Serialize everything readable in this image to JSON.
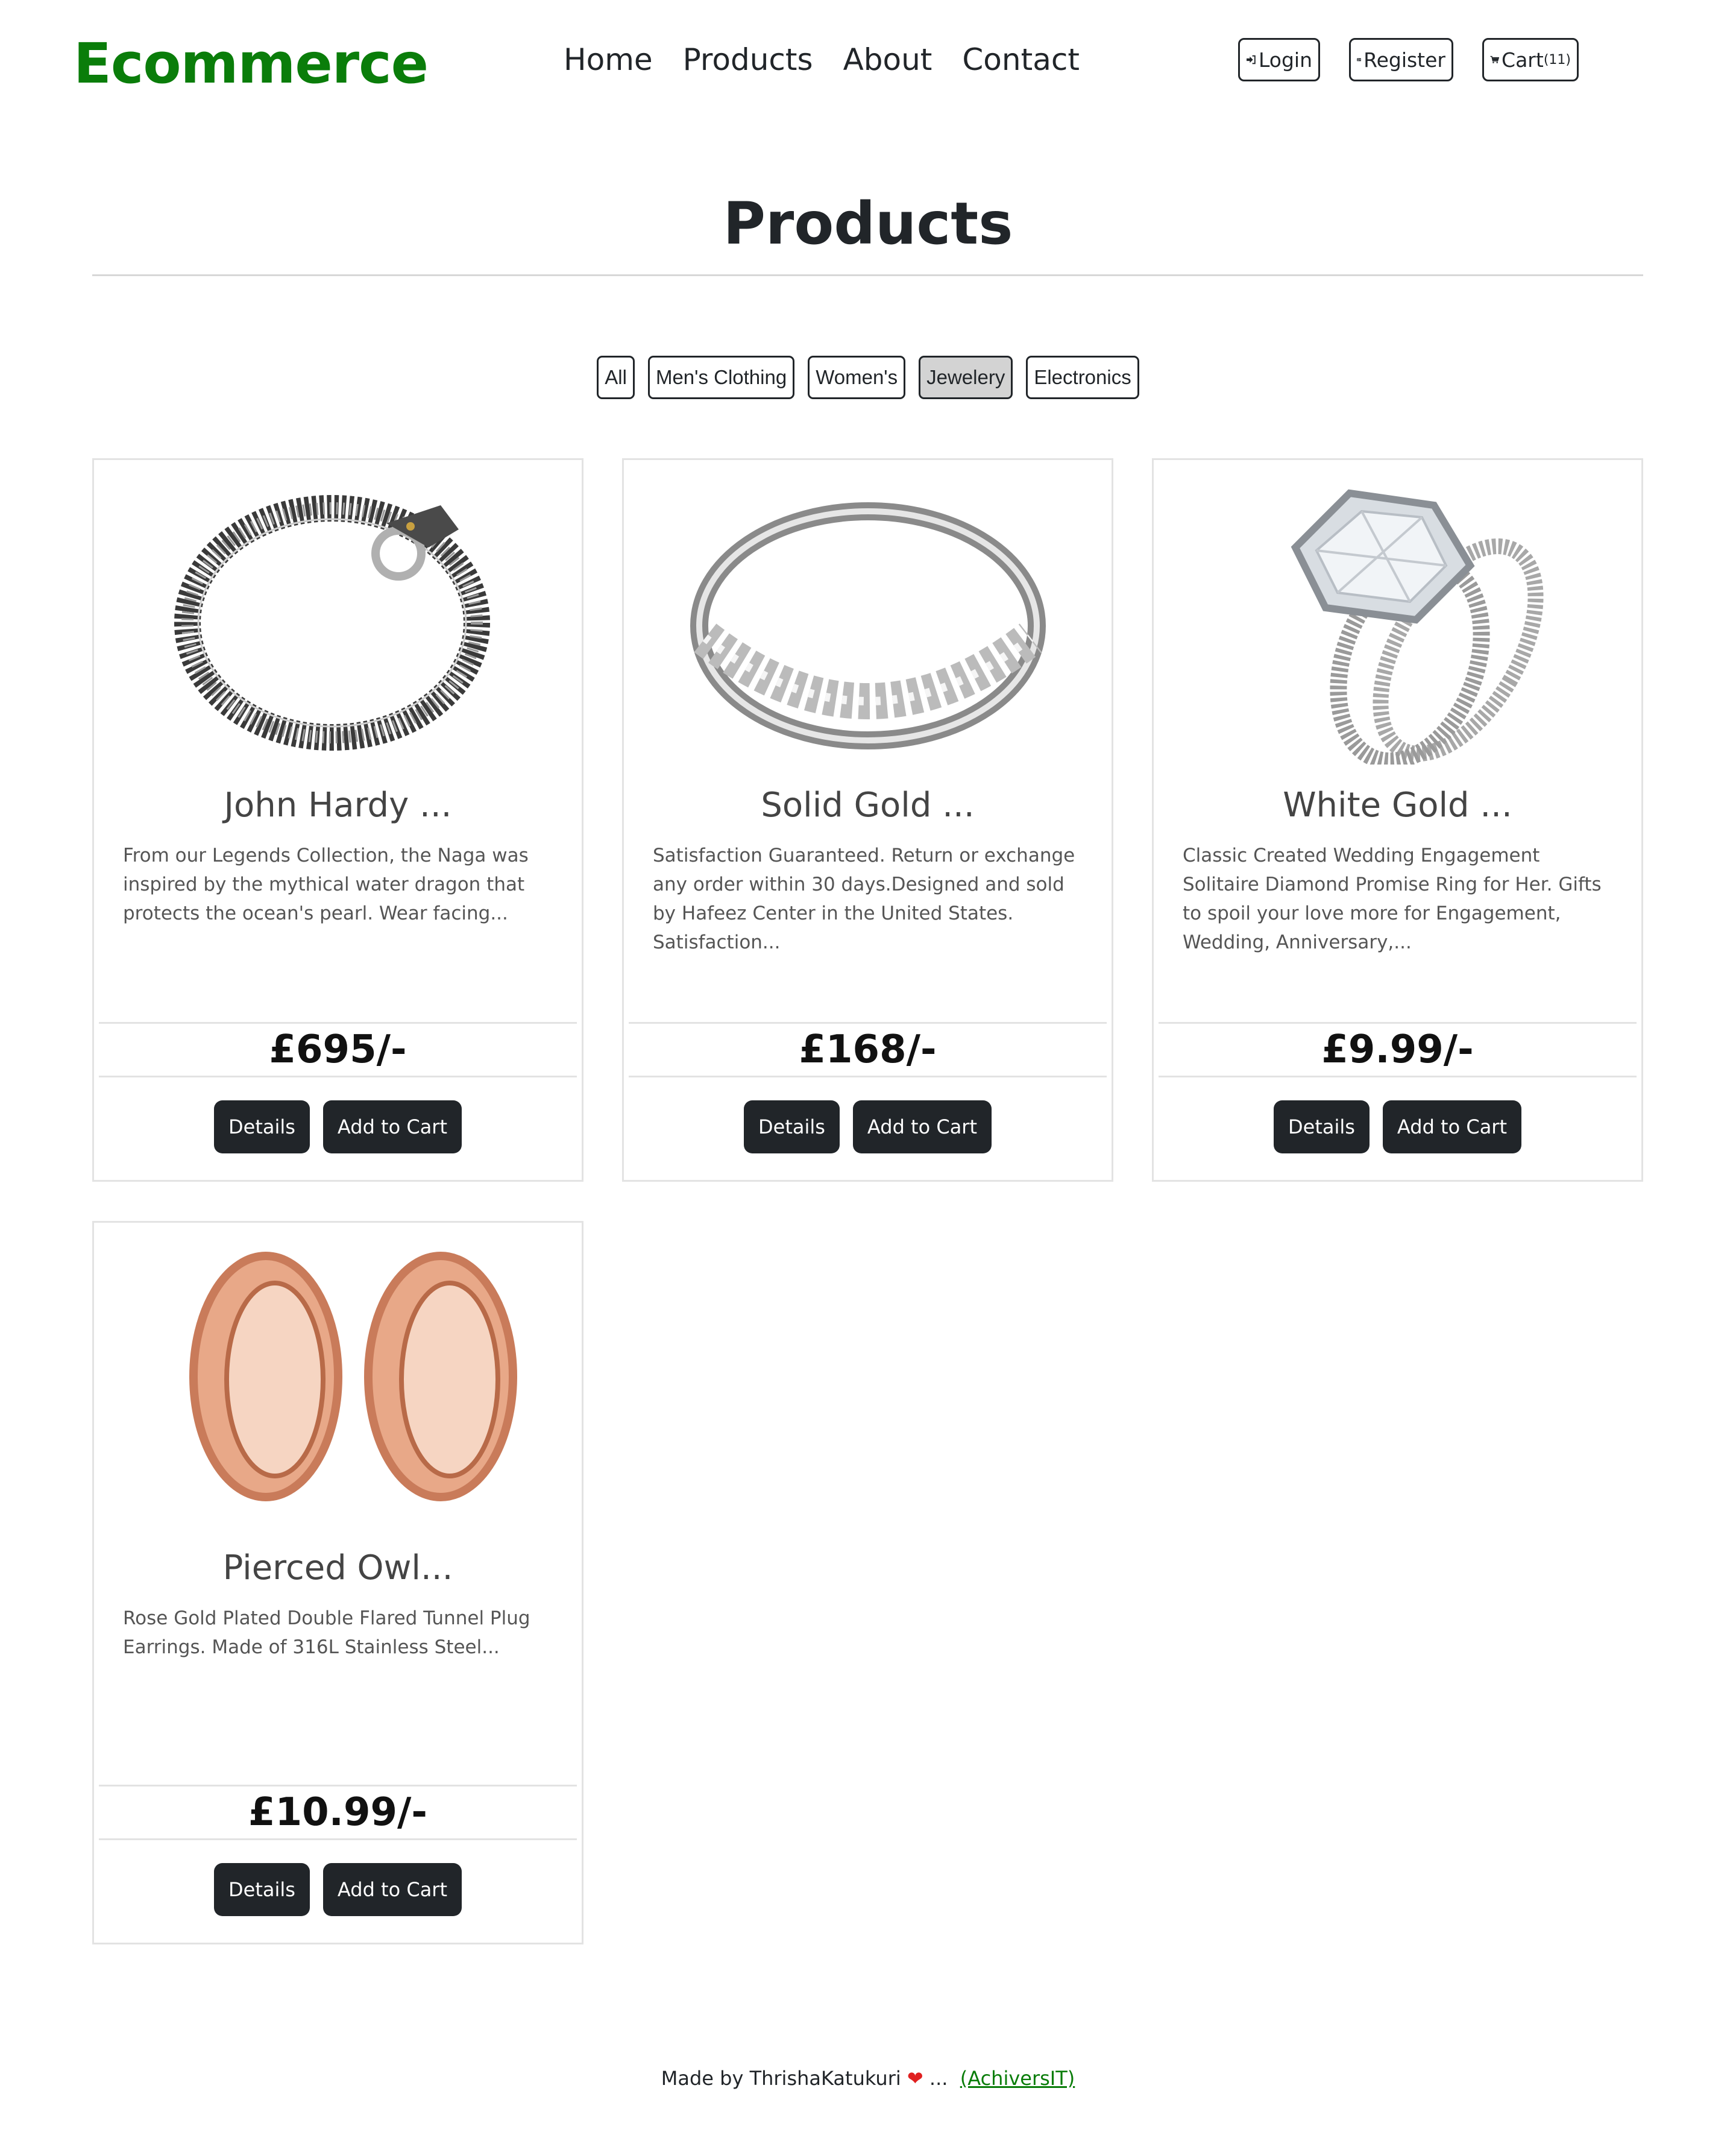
{
  "brand": "Ecommerce",
  "nav": {
    "home": "Home",
    "products": "Products",
    "about": "About",
    "contact": "Contact"
  },
  "auth": {
    "login": "Login",
    "register": "Register",
    "cart": "Cart",
    "cart_count": "(11)"
  },
  "heading": "Products",
  "filters": {
    "all": "All",
    "mens": "Men's Clothing",
    "womens": "Women's",
    "jewelery": "Jewelery",
    "electronics": "Electronics",
    "active": "Jewelery"
  },
  "products": [
    {
      "title": "John Hardy ...",
      "desc": "From our Legends Collection, the Naga was inspired by the mythical water dragon that protects the ocean's pearl. Wear facing...",
      "price": "£695/-",
      "details": "Details",
      "add": "Add to Cart",
      "image": "bracelet-image"
    },
    {
      "title": "Solid Gold ...",
      "desc": "Satisfaction Guaranteed. Return or exchange any order within 30 days.Designed and sold by Hafeez Center in the United States. Satisfaction...",
      "price": "£168/-",
      "details": "Details",
      "add": "Add to Cart",
      "image": "ring-image"
    },
    {
      "title": "White Gold ...",
      "desc": "Classic Created Wedding Engagement Solitaire Diamond Promise Ring for Her. Gifts to spoil your love more for Engagement, Wedding, Anniversary,...",
      "price": "£9.99/-",
      "details": "Details",
      "add": "Add to Cart",
      "image": "diamond-ring-image"
    },
    {
      "title": "Pierced Owl...",
      "desc": "Rose Gold Plated Double Flared Tunnel Plug Earrings. Made of 316L Stainless Steel...",
      "price": "£10.99/-",
      "details": "Details",
      "add": "Add to Cart",
      "image": "tunnel-plug-image"
    }
  ],
  "footer": {
    "made_by": "Made by ThrishaKatukuri",
    "ellipsis": "...",
    "link": "(AchiversIT)"
  },
  "colors": {
    "brand": "#0a7d0a",
    "button": "#212529",
    "active_filter": "#d3d3d3"
  }
}
